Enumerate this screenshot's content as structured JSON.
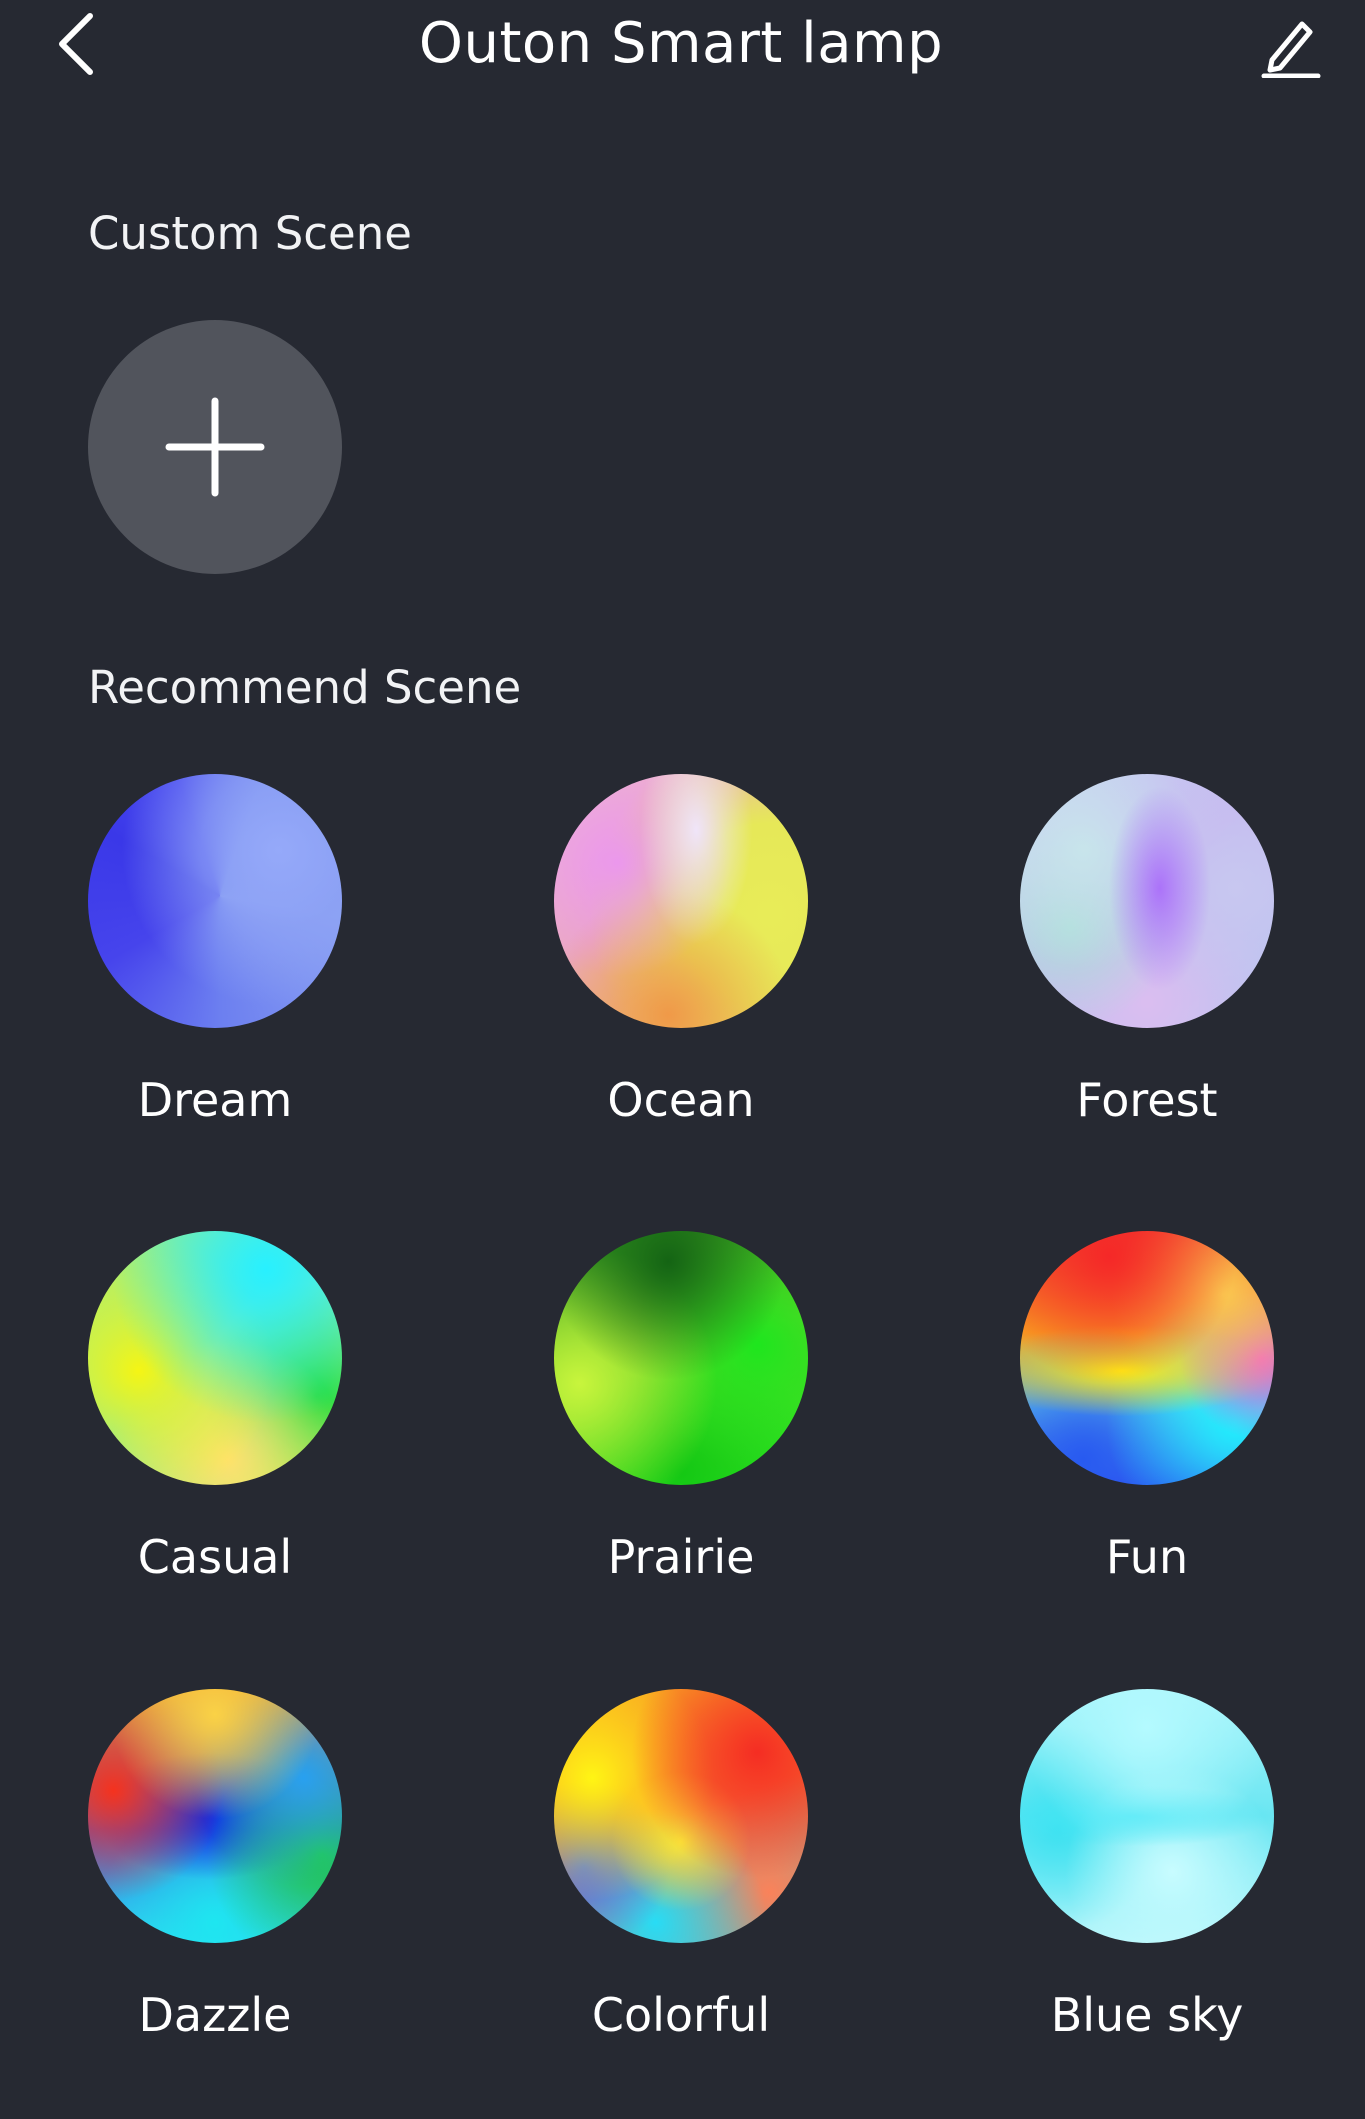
{
  "header": {
    "title": "Outon Smart lamp",
    "back_icon": "chevron-left-icon",
    "edit_icon": "pencil-icon"
  },
  "custom_section": {
    "title": "Custom Scene",
    "add_icon": "plus-icon"
  },
  "recommend_section": {
    "title": "Recommend Scene",
    "scenes": [
      {
        "label": "Dream"
      },
      {
        "label": "Ocean"
      },
      {
        "label": "Forest"
      },
      {
        "label": "Casual"
      },
      {
        "label": "Prairie"
      },
      {
        "label": "Fun"
      },
      {
        "label": "Dazzle"
      },
      {
        "label": "Colorful"
      },
      {
        "label": "Blue sky"
      }
    ]
  },
  "colors": {
    "background": "#262932",
    "add_button": "#51545c",
    "text": "#ffffff"
  }
}
